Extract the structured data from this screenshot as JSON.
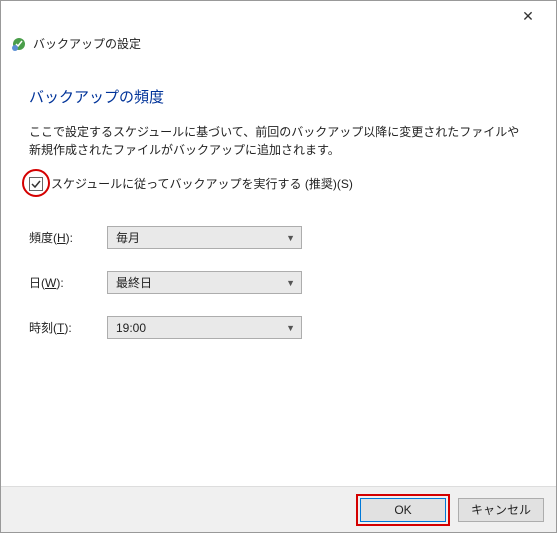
{
  "window": {
    "title": "バックアップの設定"
  },
  "main": {
    "heading": "バックアップの頻度",
    "description": "ここで設定するスケジュールに基づいて、前回のバックアップ以降に変更されたファイルや新規作成されたファイルがバックアップに追加されます。",
    "checkbox_label": "スケジュールに従ってバックアップを実行する (推奨)(S)"
  },
  "fields": {
    "frequency": {
      "label_pre": "頻度(",
      "hotkey": "H",
      "label_post": "):",
      "value": "毎月"
    },
    "day": {
      "label_pre": "日(",
      "hotkey": "W",
      "label_post": "):",
      "value": "最終日"
    },
    "time": {
      "label_pre": "時刻(",
      "hotkey": "T",
      "label_post": "):",
      "value": "19:00"
    }
  },
  "buttons": {
    "ok": "OK",
    "cancel": "キャンセル"
  }
}
